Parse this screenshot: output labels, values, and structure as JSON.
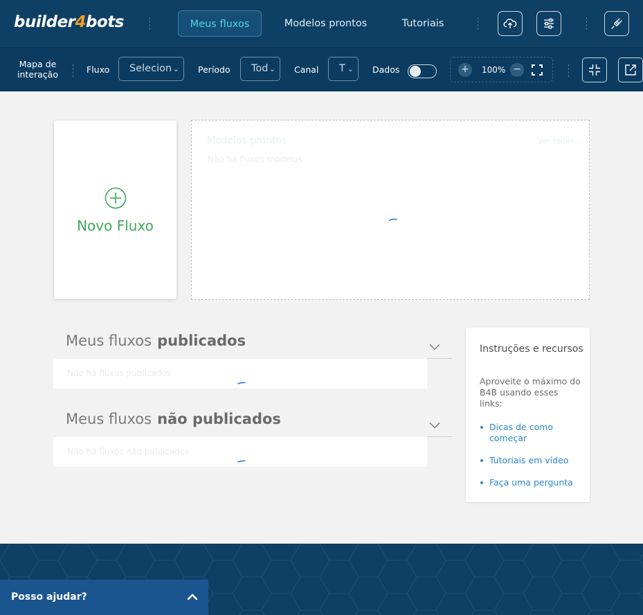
{
  "header": {
    "logo": {
      "part1": "builder",
      "part2": "4",
      "part3": "bots"
    },
    "tabs": [
      {
        "label": "Meus fluxos",
        "active": true
      },
      {
        "label": "Modelos prontos",
        "active": false
      },
      {
        "label": "Tutoriais",
        "active": false
      }
    ],
    "icons": [
      "cloud-upload-icon",
      "sliders-icon",
      "plug-icon"
    ]
  },
  "toolbar": {
    "map_label_line1": "Mapa de",
    "map_label_line2": "interação",
    "flow_label": "Fluxo",
    "flow_value": "Selecion",
    "period_label": "Período",
    "period_value": "Tod",
    "channel_label": "Canal",
    "channel_value": "T",
    "data_label": "Dados",
    "data_toggle_on": false,
    "zoom_value": "100%"
  },
  "new_flow": {
    "label": "Novo Fluxo"
  },
  "models": {
    "title": "Modelos prontos",
    "see_all": "Ver todos...",
    "empty": "Não há fluxos modelos"
  },
  "published": {
    "title_prefix": "Meus fluxos",
    "title_bold": "publicados",
    "empty": "Não há fluxos publicados"
  },
  "unpublished": {
    "title_prefix": "Meus fluxos",
    "title_bold": "não publicados",
    "empty": "Não há fluxos não publicados"
  },
  "resources": {
    "title": "Instruções e recursos",
    "description": "Aproveite o máximo do B4B usando esses links:",
    "links": [
      "Dicas de como começar",
      "Tutoriais em vídeo",
      "Faça uma pergunta"
    ]
  },
  "help": {
    "label": "Posso ajudar?"
  },
  "colors": {
    "header_bg": "#0e3f64",
    "accent_cyan": "#55d3e6",
    "logo_orange": "#f39a1e",
    "new_flow_green": "#3daa57",
    "link_blue": "#2a86c7",
    "help_bar": "#1a5590"
  }
}
